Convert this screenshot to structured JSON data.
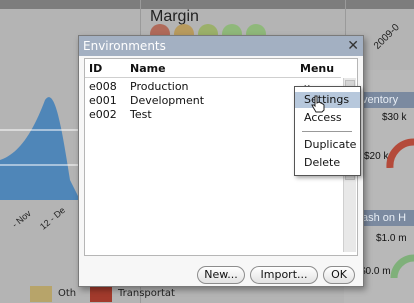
{
  "background": {
    "margin_title": "Margin",
    "date_label": "2009-0",
    "x_labels": [
      "- Nov",
      "12 - De"
    ],
    "inventory_head": "ventory",
    "inventory_values": [
      "$30 k",
      "$20 k"
    ],
    "cash_head": "ash on H",
    "cash_values": [
      "$1.0 m",
      "$0.0 m"
    ],
    "legend": [
      {
        "label": "Oth",
        "color": "#b7a46a"
      },
      {
        "label": "Transportat",
        "color": "#a23a2c"
      }
    ],
    "light_colors": [
      "#b06a5a",
      "#b89b5e",
      "#9bb06a",
      "#8fb87a",
      "#8fb87a"
    ]
  },
  "dialog": {
    "title": "Environments",
    "close_glyph": "✕",
    "columns": {
      "id": "ID",
      "name": "Name",
      "menu": "Menu"
    },
    "rows": [
      {
        "id": "e008",
        "name": "Production"
      },
      {
        "id": "e001",
        "name": "Development"
      },
      {
        "id": "e002",
        "name": "Test"
      }
    ],
    "menu_chevron": "⌄",
    "buttons": {
      "new": "New...",
      "import": "Import...",
      "ok": "OK"
    }
  },
  "context_menu": {
    "items": [
      "Settings",
      "Access",
      "Duplicate",
      "Delete"
    ],
    "highlighted": "Settings"
  },
  "colors": {
    "title_bar": "#a3b0c2",
    "highlight": "#b7c8dc",
    "area_chart": "#4f86b8"
  }
}
